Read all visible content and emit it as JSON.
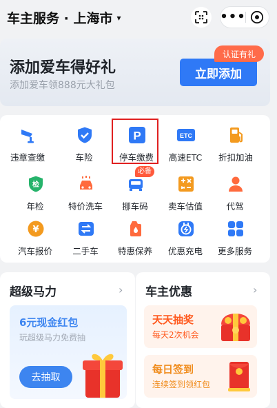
{
  "header": {
    "title": "车主服务 · 上海市",
    "caret": "▾",
    "more_label": "•••"
  },
  "banner": {
    "title": "添加爱车得好礼",
    "subtitle": "添加爱车领888元大礼包",
    "cta_label": "立即添加",
    "tag_label": "认证有礼"
  },
  "services": [
    {
      "label": "违章查缴",
      "icon": "camera-icon"
    },
    {
      "label": "车险",
      "icon": "shield-check-icon"
    },
    {
      "label": "停车缴费",
      "icon": "parking-icon"
    },
    {
      "label": "高速ETC",
      "icon": "etc-icon"
    },
    {
      "label": "折扣加油",
      "icon": "fuel-pump-icon"
    },
    {
      "label": "年检",
      "icon": "inspection-icon"
    },
    {
      "label": "特价洗车",
      "icon": "car-wash-icon"
    },
    {
      "label": "挪车码",
      "icon": "move-car-icon"
    },
    {
      "label": "卖车估值",
      "icon": "calculator-icon"
    },
    {
      "label": "代驾",
      "icon": "driver-icon"
    },
    {
      "label": "汽车报价",
      "icon": "yuan-coin-icon"
    },
    {
      "label": "二手车",
      "icon": "used-car-icon"
    },
    {
      "label": "特惠保养",
      "icon": "oil-can-icon"
    },
    {
      "label": "优惠充电",
      "icon": "charging-plug-icon"
    },
    {
      "label": "更多服务",
      "icon": "grid-icon"
    }
  ],
  "must_badge": "必备",
  "superpower": {
    "title": "超级马力",
    "promo_title": "6元现金红包",
    "promo_subtitle": "玩超级马力免费抽",
    "promo_button": "去抽取"
  },
  "owner_perks": {
    "title": "车主优惠",
    "items": [
      {
        "title": "天天抽奖",
        "subtitle": "每天2次机会",
        "title_color": "#ff5a1f",
        "subtitle_color": "#ff5a1f"
      },
      {
        "title": "每日签到",
        "subtitle": "连续签到领红包",
        "title_color": "#f08c1d",
        "subtitle_color": "#f08c1d"
      }
    ]
  },
  "colors": {
    "accent_blue": "#2f79f6",
    "tag_orange": "#ff6b4a",
    "highlight_red": "#e02020"
  }
}
